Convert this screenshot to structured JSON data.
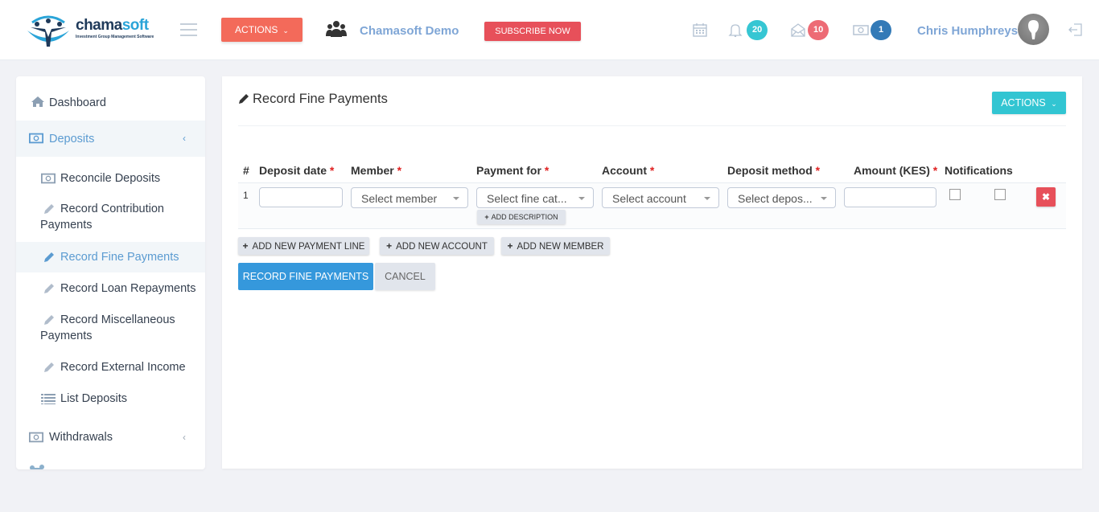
{
  "header": {
    "logo": {
      "brand_main": "chama",
      "brand_accent": "soft",
      "tagline": "Investment Group Management Software"
    },
    "actions_label": "ACTIONS",
    "group_name": "Chamasoft Demo",
    "subscribe_label": "SUBSCRIBE NOW",
    "notifications": [
      {
        "icon": "calendar-icon",
        "count": null
      },
      {
        "icon": "bell-icon",
        "count": "20",
        "color": "#36c6d3"
      },
      {
        "icon": "envelope-open-icon",
        "count": "10",
        "color": "#ed6b75"
      },
      {
        "icon": "money-icon",
        "count": "1",
        "color": "#337ab7"
      }
    ],
    "user_name": "Chris Humphreys"
  },
  "sidebar": {
    "items": [
      {
        "label": "Dashboard",
        "icon": "home-icon"
      },
      {
        "label": "Deposits",
        "icon": "money-icon",
        "expanded": true
      },
      {
        "label": "Reconcile Deposits",
        "icon": "money-icon"
      },
      {
        "label": "Record Contribution Payments",
        "icon": "pencil-icon"
      },
      {
        "label": "Record Fine Payments",
        "icon": "pencil-icon",
        "active": true
      },
      {
        "label": "Record Loan Repayments",
        "icon": "pencil-icon"
      },
      {
        "label": "Record Miscellaneous Payments",
        "icon": "pencil-icon"
      },
      {
        "label": "Record External Income",
        "icon": "pencil-icon"
      },
      {
        "label": "List Deposits",
        "icon": "list-icon"
      },
      {
        "label": "Withdrawals",
        "icon": "money-icon"
      }
    ],
    "deposits_line1": "Record Contribution",
    "deposits_line2": "Payments",
    "misc_line1": "Record Miscellaneous",
    "misc_line2": "Payments"
  },
  "main": {
    "title": "Record Fine Payments",
    "actions_label": "ACTIONS",
    "table": {
      "columns": [
        {
          "label": "#",
          "required": false
        },
        {
          "label": "Deposit date",
          "required": true
        },
        {
          "label": "Member",
          "required": true
        },
        {
          "label": "Payment for",
          "required": true
        },
        {
          "label": "Account",
          "required": true
        },
        {
          "label": "Deposit method",
          "required": true
        },
        {
          "label": "Amount (KES)",
          "required": true
        },
        {
          "label": "Notifications",
          "required": false
        }
      ],
      "required_mark": "*",
      "rows": [
        {
          "number": "1",
          "deposit_date": "",
          "member_placeholder": "Select member",
          "payment_for_placeholder": "Select fine cat...",
          "account_placeholder": "Select account",
          "deposit_method_placeholder": "Select depos...",
          "amount": "",
          "notify_sms": false,
          "notify_email": false,
          "add_description_label": "ADD DESCRIPTION"
        }
      ]
    },
    "buttons": {
      "add_payment_line": "ADD NEW PAYMENT LINE",
      "add_account": "ADD NEW ACCOUNT",
      "add_member": "ADD NEW MEMBER",
      "submit": "RECORD FINE PAYMENTS",
      "cancel": "CANCEL"
    }
  }
}
